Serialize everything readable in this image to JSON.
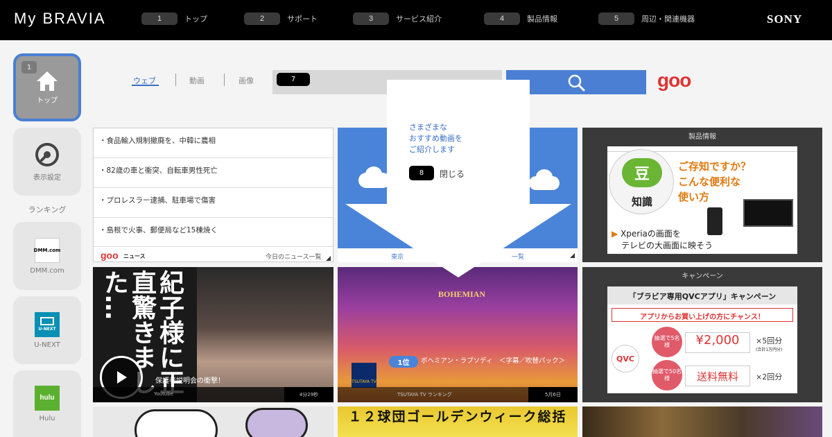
{
  "header": {
    "brand": "My BRAVIA",
    "nav": [
      {
        "key": "1",
        "label": "トップ"
      },
      {
        "key": "2",
        "label": "サポート"
      },
      {
        "key": "3",
        "label": "サービス紹介"
      },
      {
        "key": "4",
        "label": "製品情報"
      },
      {
        "key": "5",
        "label": "周辺・関連機器"
      }
    ],
    "logo": "SONY"
  },
  "sidebar": {
    "home": {
      "key": "1",
      "label": "トップ"
    },
    "settings": {
      "label": "表示設定"
    },
    "ranking_label": "ランキング",
    "apps": [
      {
        "label": "DMM.com",
        "logo_text": "DMM.com"
      },
      {
        "label": "U-NEXT",
        "logo_text": "U-NEXT"
      },
      {
        "label": "Hulu",
        "logo_text": "hulu"
      }
    ]
  },
  "search": {
    "tabs": [
      "ウェブ",
      "動画",
      "画像"
    ],
    "active_tab": "ウェブ",
    "key": "7",
    "provider": "goo"
  },
  "news": {
    "items": [
      "・食品輸入規制撤廃を、中韓に農相",
      "・82歳の車と衝突、自転車男性死亡",
      "・プロレスラー逮捕、駐車場で傷害",
      "・島根で火事、郵便局など15棟焼く"
    ],
    "source_logo": "goo",
    "source_sub": "ニュース",
    "more_link": "今日のニュース一覧"
  },
  "weather": {
    "location": "東京",
    "more_link": "一覧"
  },
  "product_panel": {
    "title": "製品情報",
    "badge": "豆",
    "badge_sub": "知識",
    "headline": [
      "ご存知ですか？",
      "こんな便利な",
      "使い方"
    ],
    "caption": [
      "Xperiaの画面を",
      "テレビの大画面に映そう"
    ]
  },
  "campaign_panel": {
    "title": "キャンペーン",
    "banner_title": "「ブラビア専用QVCアプリ」キャンペーン",
    "banner_sub": "アプリからお買い上げの方にチャンス！",
    "prize1": {
      "lottery": "抽選で5名様",
      "amount": "¥2,000",
      "times": "×5回分",
      "note": "(合計1万円分)"
    },
    "prize2": {
      "lottery": "抽選で50名様",
      "amount": "送料無料",
      "times": "×2回分"
    },
    "brand": "QVC"
  },
  "video_1": {
    "caption": "保護者説明会の衝撃！",
    "source": "Youtube",
    "duration": "4分29秒",
    "overlay_text": [
      "紀子様に",
      "正直驚き",
      "ました…"
    ]
  },
  "video_2": {
    "rank": "1位",
    "title": "ボヘミアン・ラプソディ　＜字幕／吹替パック＞",
    "source": "TSUTAYA TV ランキング",
    "date": "5月6日",
    "poster_text": "BOHEMIAN",
    "logo": "TSUTAYA TV"
  },
  "popup": {
    "message": [
      "さまざまな",
      "おすすめ動画を",
      "ご紹介します"
    ],
    "key": "8",
    "close_label": "閉じる"
  },
  "bottom_row": {
    "card_2_text": "１２球団ゴールデンウィーク総括"
  }
}
